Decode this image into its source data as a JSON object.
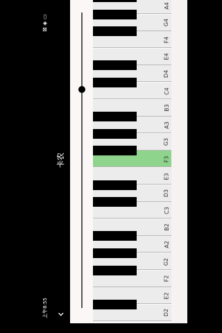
{
  "status": {
    "time": "上午8:55",
    "icons": "⊠ ◈ ▭"
  },
  "header": {
    "back_icon": "chevron-left-icon",
    "title": "卡农"
  },
  "slider": {
    "value": 0.26
  },
  "piano": {
    "highlight_color": "#8fd48d",
    "white_keys": [
      "A4",
      "G4",
      "F4",
      "E4",
      "D4",
      "C4",
      "B3",
      "A3",
      "G3",
      "F3",
      "E3",
      "D3",
      "C3",
      "B2",
      "A2",
      "G2",
      "F2",
      "E2",
      "D2"
    ],
    "active_key": "F3"
  }
}
